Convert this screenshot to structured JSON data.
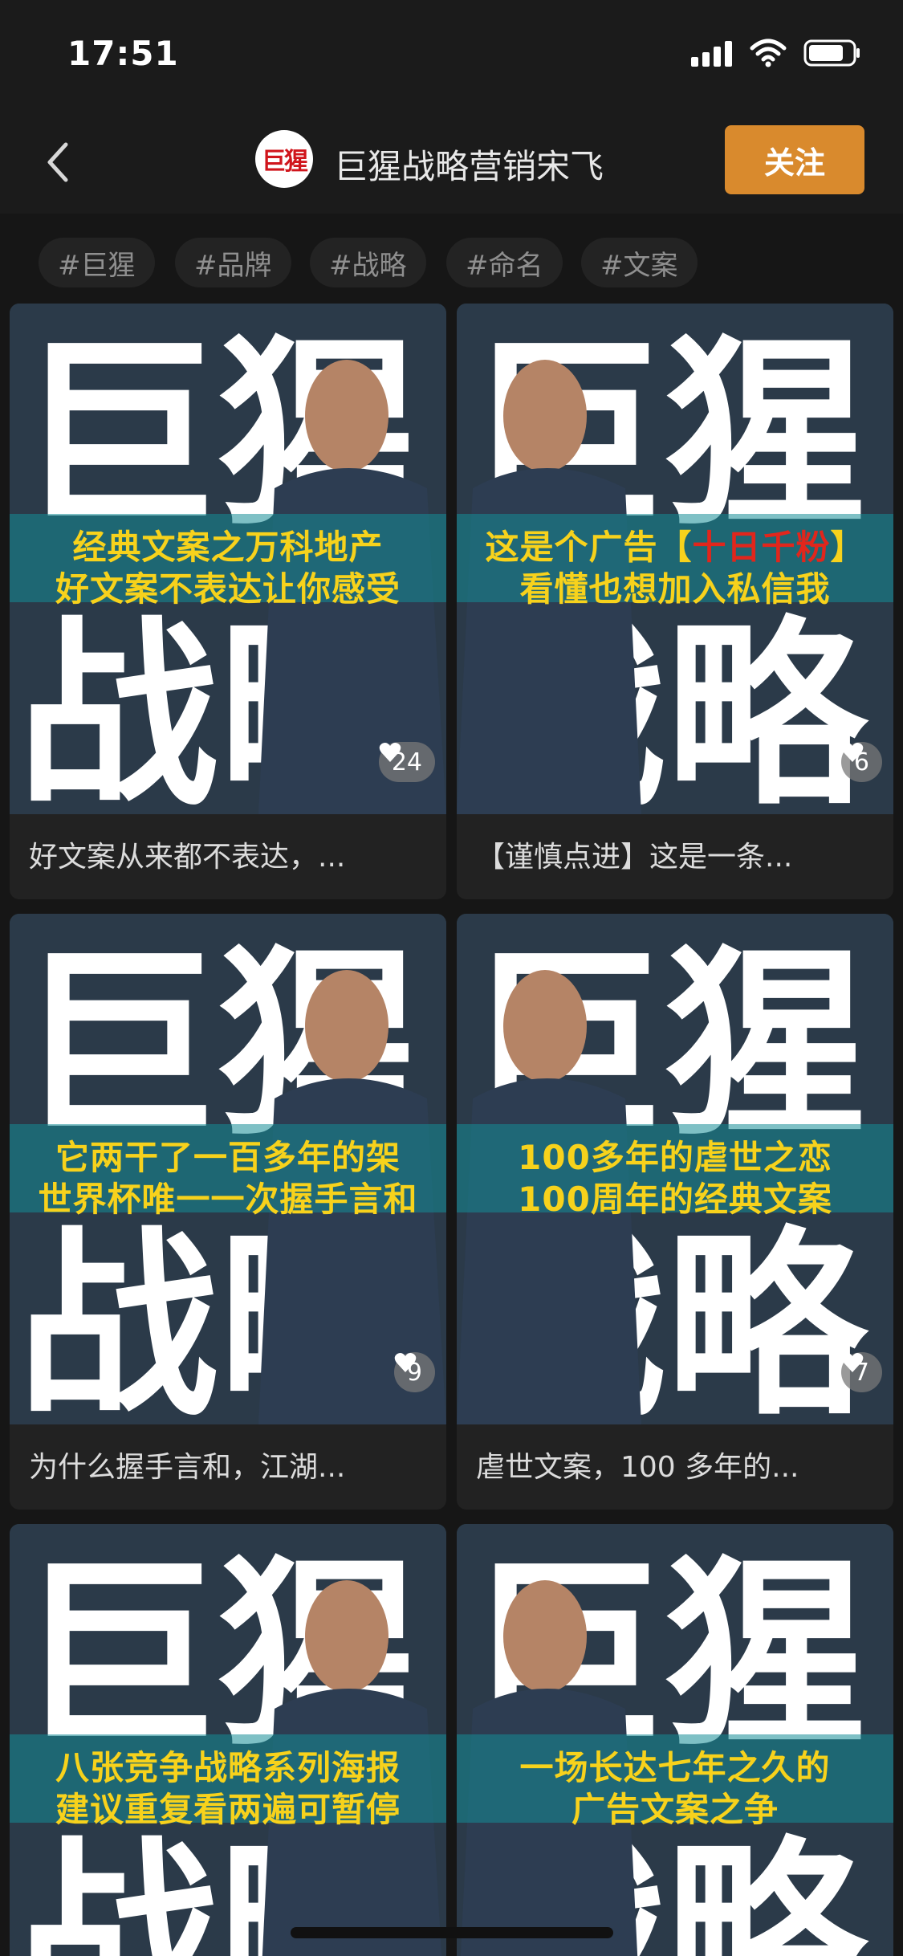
{
  "status": {
    "time": "17:51",
    "icons": [
      "signal-icon",
      "wifi-icon",
      "battery-icon"
    ]
  },
  "nav": {
    "back_icon": "chevron-left-icon",
    "avatar_text": "巨猩",
    "title": "巨猩战略营销宋飞",
    "follow_label": "关注"
  },
  "tags": [
    "#巨猩",
    "#品牌",
    "#战略",
    "#命名",
    "#文案"
  ],
  "colors": {
    "accent": "#d98a2d",
    "caption_yellow": "#f7d21c",
    "caption_red": "#e1261c",
    "background": "#161616",
    "card": "#222222"
  },
  "cover_text": {
    "top": "巨猩",
    "bottom": "战略"
  },
  "cards": [
    {
      "caption_line1": "经典文案之万科地产",
      "caption_line2": "好文案不表达让你感受",
      "likes": "24",
      "title": "好文案从来都不表达，..."
    },
    {
      "caption_line1_pre": "这是个广告【",
      "caption_line1_highlight": "十日千粉",
      "caption_line1_post": "】",
      "caption_line2": "看懂也想加入私信我",
      "likes": "6",
      "title": "【谨慎点进】这是一条..."
    },
    {
      "caption_line1": "它两干了一百多年的架",
      "caption_line2": "世界杯唯一一次握手言和",
      "likes": "9",
      "title": "为什么握手言和，江湖..."
    },
    {
      "caption_line1": "100多年的虐世之恋",
      "caption_line2": "100周年的经典文案",
      "likes": "7",
      "title": "虐世文案，100 多年的..."
    },
    {
      "caption_line1": "八张竞争战略系列海报",
      "caption_line2": "建议重复看两遍可暂停"
    },
    {
      "caption_line1": "一场长达七年之久的",
      "caption_line2": "广告文案之争"
    }
  ]
}
